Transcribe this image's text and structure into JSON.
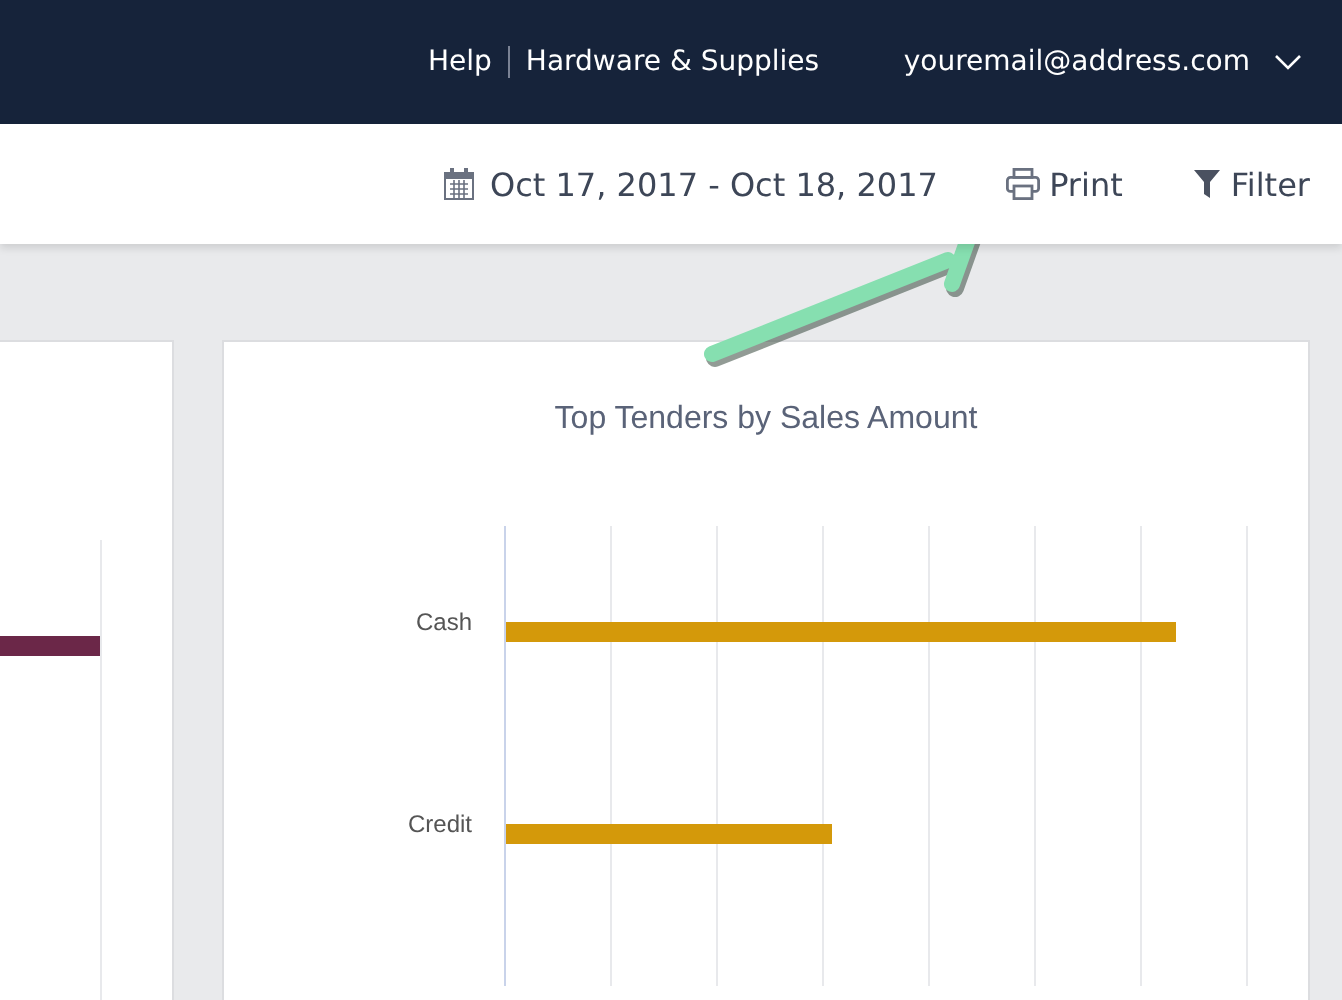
{
  "top_nav": {
    "links": [
      "Help",
      "Hardware & Supplies"
    ],
    "account": "youremail@address.com"
  },
  "toolbar": {
    "date_range": "Oct 17, 2017 - Oct 18, 2017",
    "print": "Print",
    "filter": "Filter"
  },
  "chart": {
    "title": "Top Tenders by Sales Amount",
    "categories": [
      "Cash",
      "Credit"
    ]
  }
}
